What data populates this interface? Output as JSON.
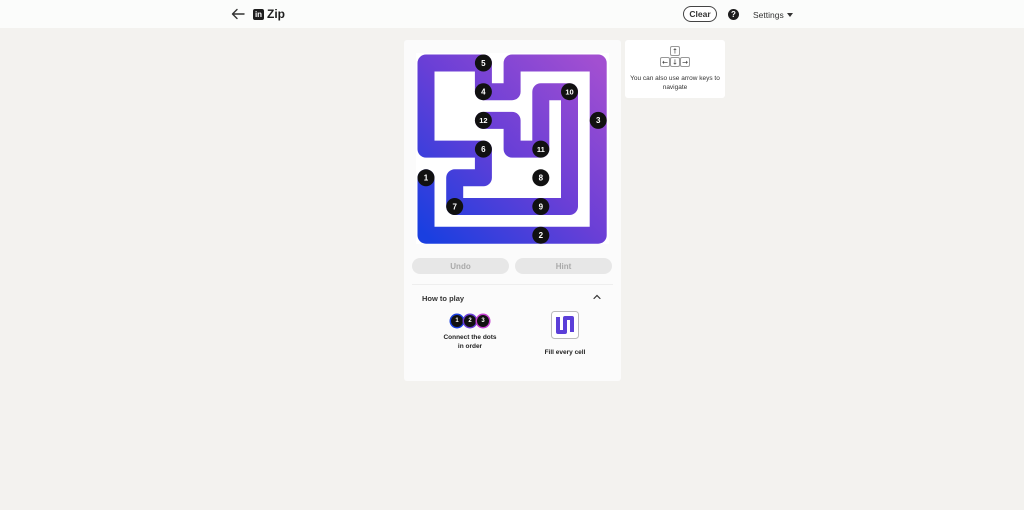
{
  "header": {
    "title": "Zip",
    "logo_text": "in",
    "clear_label": "Clear",
    "help_label": "?",
    "settings_label": "Settings"
  },
  "board": {
    "grid_size": 6,
    "dots": [
      {
        "label": "1",
        "col": 0,
        "row": 4.0
      },
      {
        "label": "2",
        "col": 4,
        "row": 6.0
      },
      {
        "label": "3",
        "col": 6,
        "row": 2.0
      },
      {
        "label": "4",
        "col": 2,
        "row": 1.0
      },
      {
        "label": "5",
        "col": 2,
        "row": 0.0
      },
      {
        "label": "6",
        "col": 2,
        "row": 3.0
      },
      {
        "label": "7",
        "col": 1,
        "row": 5.0
      },
      {
        "label": "8",
        "col": 4,
        "row": 4.0
      },
      {
        "label": "9",
        "col": 4,
        "row": 5.0
      },
      {
        "label": "10",
        "col": 5,
        "row": 1.0
      },
      {
        "label": "11",
        "col": 4,
        "row": 3.0
      },
      {
        "label": "12",
        "col": 2,
        "row": 2.0
      }
    ]
  },
  "controls": {
    "undo_label": "Undo",
    "hint_label": "Hint"
  },
  "how_to_play": {
    "title": "How to play",
    "tip1_dots": [
      "1",
      "2",
      "3"
    ],
    "tip1_text": "Connect the dots in order",
    "tip2_text": "Fill every cell"
  },
  "keys_tip": {
    "text": "You can also use arrow keys to navigate",
    "keys": [
      "↑",
      "←",
      "↓",
      "→"
    ]
  },
  "colors": {
    "path_start": "#1a3fe0",
    "path_mid": "#6a3fd6",
    "path_end": "#a24fd1",
    "dot": "#111111",
    "background": "#f3f2ef"
  }
}
